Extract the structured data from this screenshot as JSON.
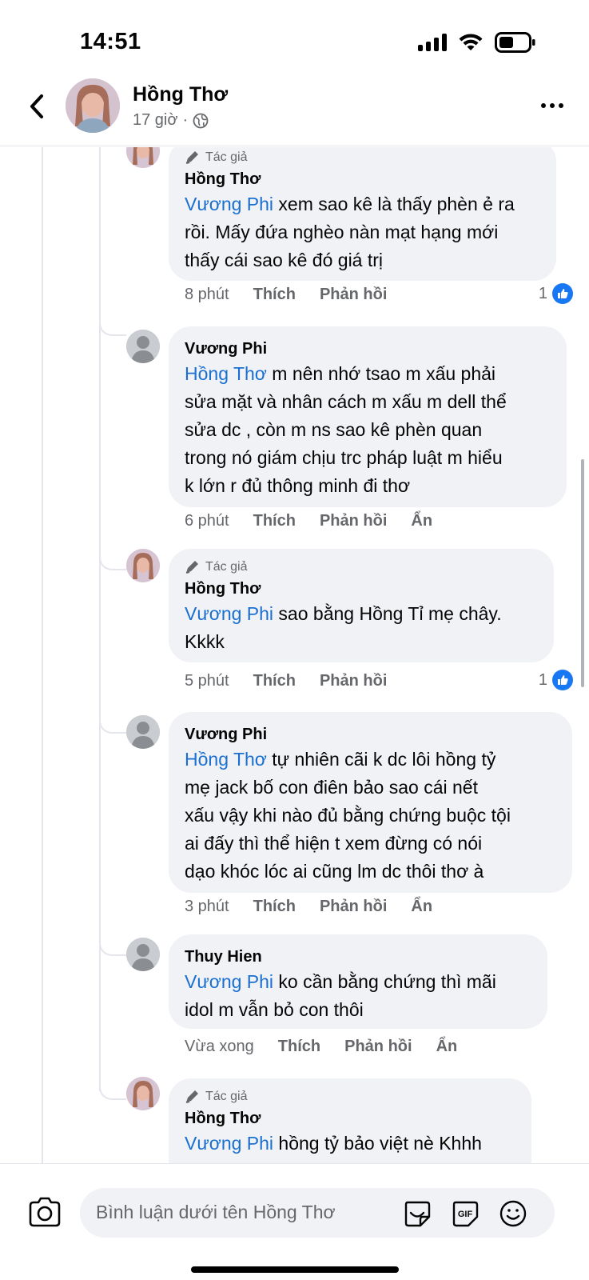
{
  "status": {
    "time": "14:51"
  },
  "header": {
    "name": "Hồng Thơ",
    "time": "17 giờ",
    "separator": "·"
  },
  "labels": {
    "author_badge": "Tác giả",
    "like": "Thích",
    "reply": "Phản hồi",
    "hide": "Ẩn"
  },
  "comments": [
    {
      "name": "Hồng Thơ",
      "is_author": true,
      "mention": "Vương Phi",
      "text_lines": [
        " xem sao kê là thấy phèn ẻ ra",
        "rồi. Mấy đứa nghèo nàn mạt hạng mới",
        "thấy cái sao kê đó giá trị"
      ],
      "time": "8 phút",
      "reaction_count": "1"
    },
    {
      "name": "Vương Phi",
      "is_author": false,
      "mention": "Hồng Thơ",
      "text_lines": [
        " m nên nhớ tsao m xấu phải",
        "sửa mặt và nhân cách m xấu m dell thể",
        "sửa dc , còn m ns sao kê phèn quan",
        "trong nó giám chịu trc pháp luật m hiểu",
        "k lớn r đủ thông minh đi thơ"
      ],
      "time": "6 phút"
    },
    {
      "name": "Hồng Thơ",
      "is_author": true,
      "mention": "Vương Phi",
      "text_lines": [
        " sao bằng Hồng Tỉ mẹ chây.",
        "Kkkk"
      ],
      "time": "5 phút",
      "reaction_count": "1"
    },
    {
      "name": "Vương Phi",
      "is_author": false,
      "mention": "Hồng Thơ",
      "text_lines": [
        " tự nhiên cãi k dc lôi hồng tỷ",
        "mẹ jack bố con điên bảo sao cái nết",
        "xấu vậy khi nào đủ bằng chứng buộc tội",
        "ai đấy thì thể hiện t xem đừng có nói",
        "dạo khóc lóc ai cũng lm dc thôi thơ à"
      ],
      "time": "3 phút"
    },
    {
      "name": "Thuy Hien",
      "is_author": false,
      "mention": "Vương Phi",
      "text_lines": [
        " ko cần bằng chứng thì mãi",
        "idol m vẫn bỏ con thôi"
      ],
      "time": "Vừa xong"
    },
    {
      "name": "Hồng Thơ",
      "is_author": true,
      "mention": "Vương Phi",
      "text_lines": [
        " hồng tỷ bảo việt nè Khhh"
      ]
    }
  ],
  "composer": {
    "placeholder": "Bình luận dưới tên Hồng Thơ",
    "gif_label": "GIF"
  },
  "colors": {
    "mention": "#1a6fd1",
    "like_blue": "#1877f2",
    "bubble": "#f0f2f5",
    "meta_gray": "#65676b"
  },
  "icons": {
    "back": "chevron-left-icon",
    "more": "more-horizontal-icon",
    "privacy": "globe-icon",
    "author": "pencil-icon",
    "camera": "camera-icon",
    "sticker": "sticker-icon",
    "gif": "gif-icon",
    "emoji": "emoji-icon"
  }
}
